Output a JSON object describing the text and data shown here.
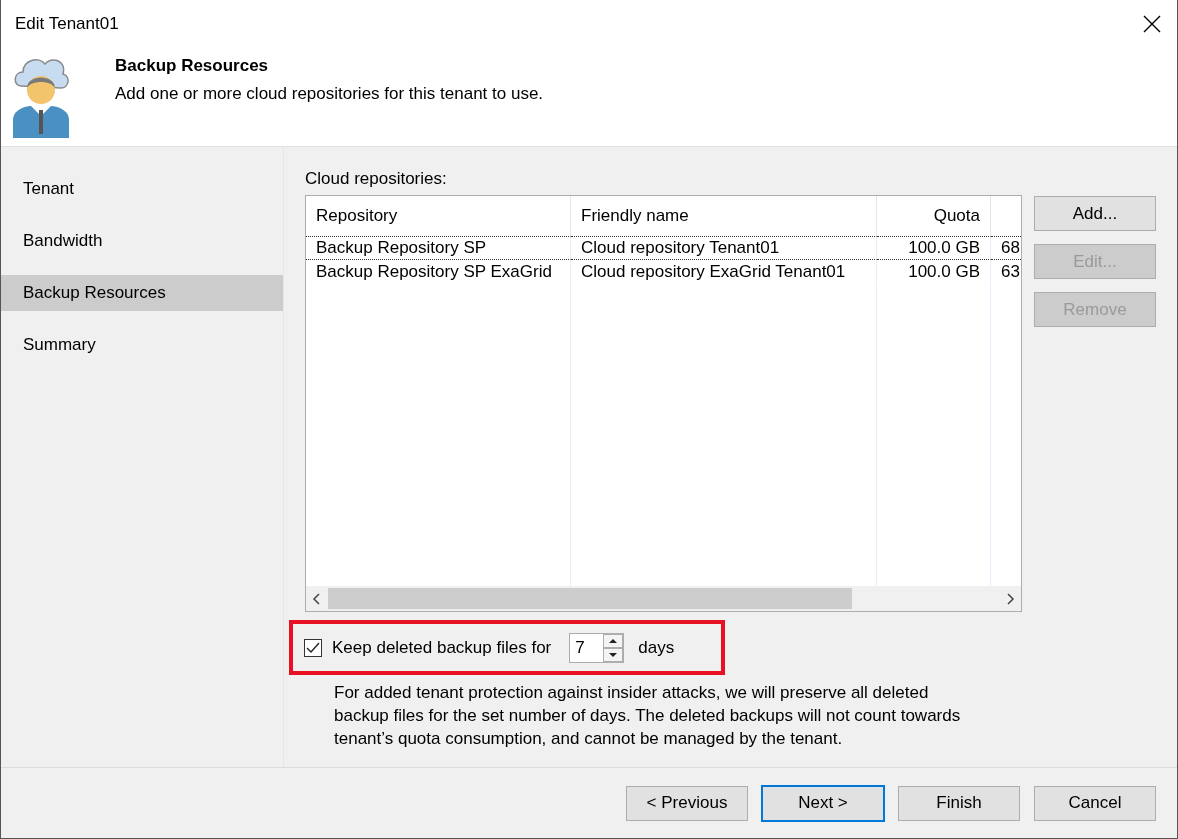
{
  "window": {
    "title": "Edit Tenant01"
  },
  "header": {
    "title": "Backup Resources",
    "subtitle": "Add one or more cloud repositories for this tenant to use."
  },
  "sidebar": {
    "items": [
      {
        "label": "Tenant",
        "selected": false
      },
      {
        "label": "Bandwidth",
        "selected": false
      },
      {
        "label": "Backup Resources",
        "selected": true
      },
      {
        "label": "Summary",
        "selected": false
      }
    ]
  },
  "repositories": {
    "label": "Cloud repositories:",
    "columns": [
      "Repository",
      "Friendly name",
      "Quota"
    ],
    "rows": [
      {
        "cells": [
          "Backup Repository SP",
          "Cloud repository Tenant01",
          "100.0 GB",
          "68"
        ],
        "selected": true
      },
      {
        "cells": [
          "Backup Repository SP ExaGrid",
          "Cloud repository ExaGrid Tenant01",
          "100.0 GB",
          "63"
        ],
        "selected": false
      }
    ]
  },
  "side_buttons": [
    {
      "label": "Add...",
      "disabled": false
    },
    {
      "label": "Edit...",
      "disabled": true
    },
    {
      "label": "Remove",
      "disabled": true
    }
  ],
  "retention": {
    "label": "Keep deleted backup files for",
    "checked": true,
    "value": "7",
    "unit": "days",
    "highlighted": true
  },
  "note": "For added tenant protection against insider attacks, we will preserve all deleted backup files for the set number of days. The deleted backups will not count towards tenant’s quota consumption, and cannot be managed by the tenant.",
  "buttons": [
    {
      "label": "< Previous",
      "default": false
    },
    {
      "label": "Next >",
      "default": true
    },
    {
      "label": "Finish",
      "default": false
    },
    {
      "label": "Cancel",
      "default": false
    }
  ]
}
